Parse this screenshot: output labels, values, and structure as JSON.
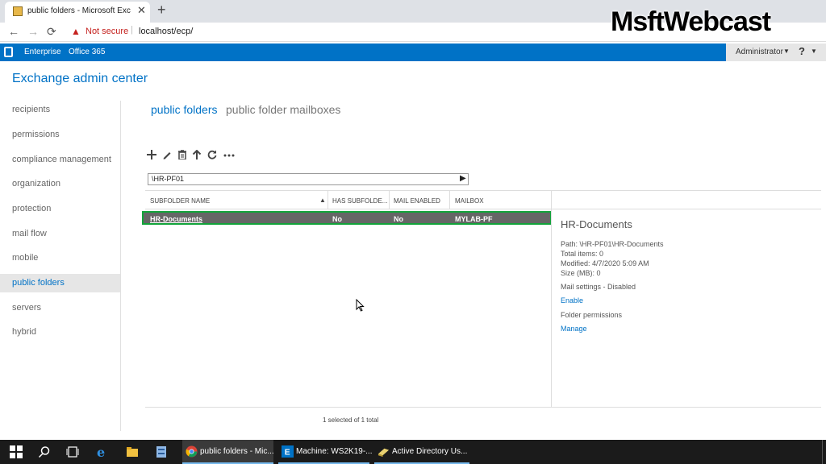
{
  "browser": {
    "tab_title": "public folders - Microsoft Exchan",
    "new_tab": "+",
    "close": "✕",
    "back": "←",
    "forward": "→",
    "reload": "⟳",
    "security_text": "Not secure",
    "separator": "|",
    "url": "localhost/ecp/"
  },
  "watermark": "MsftWebcast",
  "o365": {
    "nav": [
      "Enterprise",
      "Office 365"
    ],
    "user": "Administrator",
    "help": "?",
    "caret": "▼"
  },
  "app_title": "Exchange admin center",
  "sidebar": {
    "items": [
      {
        "label": "recipients"
      },
      {
        "label": "permissions"
      },
      {
        "label": "compliance management"
      },
      {
        "label": "organization"
      },
      {
        "label": "protection"
      },
      {
        "label": "mail flow"
      },
      {
        "label": "mobile"
      },
      {
        "label": "public folders",
        "selected": true
      },
      {
        "label": "servers"
      },
      {
        "label": "hybrid"
      }
    ]
  },
  "tabs": [
    "public folders",
    "public folder mailboxes"
  ],
  "toolbar_icons": [
    "add-icon",
    "edit-icon",
    "delete-icon",
    "up-icon",
    "refresh-icon",
    "more-icon"
  ],
  "path": {
    "value": "\\HR-PF01",
    "go": "▶"
  },
  "grid": {
    "columns": [
      "SUBFOLDER NAME",
      "HAS SUBFOLDE...",
      "MAIL ENABLED",
      "MAILBOX"
    ],
    "sort_indicator": "▲",
    "rows": [
      {
        "name": "HR-Documents",
        "has_subfolders": "No",
        "mail_enabled": "No",
        "mailbox": "MYLAB-PF"
      }
    ],
    "status": "1 selected of 1 total"
  },
  "details": {
    "title": "HR-Documents",
    "path": "Path: \\HR-PF01\\HR-Documents",
    "total_items": "Total items: 0",
    "modified": "Modified: 4/7/2020 5:09 AM",
    "size": "Size (MB): 0",
    "mail_settings": "Mail settings - Disabled",
    "enable_link": "Enable",
    "folder_permissions": "Folder permissions",
    "manage_link": "Manage"
  },
  "taskbar": {
    "apps": [
      {
        "label": "public folders - Mic...",
        "icon": "chrome-icon"
      },
      {
        "label": "Machine: WS2K19-...",
        "icon": "exchange-icon"
      },
      {
        "label": "Active Directory Us...",
        "icon": "ad-users-icon"
      }
    ]
  },
  "colors": {
    "accent": "#0072c6",
    "selection_border": "#12a33a",
    "row_bg": "#666666"
  }
}
